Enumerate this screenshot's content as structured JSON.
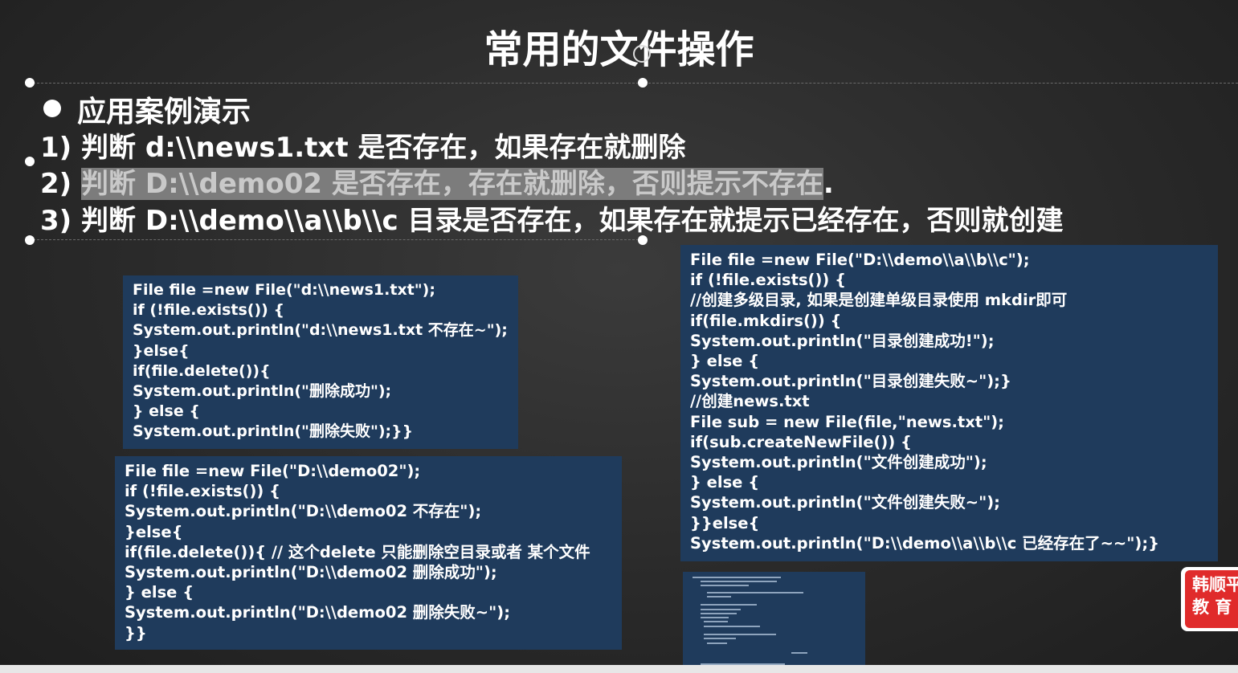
{
  "slide": {
    "title": "常用的文件操作",
    "heading": "应用案例演示",
    "items": [
      {
        "number": "1)",
        "text": "判断 d:\\\\news1.txt 是否存在，如果存在就删除"
      },
      {
        "number": "2)",
        "text_highlighted": "判断 D:\\\\demo02 是否存在，存在就删除，否则提示不存在",
        "text_tail": "."
      },
      {
        "number": "3)",
        "text": "判断 D:\\\\demo\\\\a\\\\b\\\\c 目录是否存在，如果存在就提示已经存在，否则就创建"
      }
    ]
  },
  "code_blocks": {
    "news1": [
      "File file =new File(\"d:\\\\news1.txt\");",
      "if (!file.exists()) {",
      "System.out.println(\"d:\\\\news1.txt 不存在~\");",
      "}else{",
      "if(file.delete()){",
      "System.out.println(\"删除成功\");",
      "} else {",
      "System.out.println(\"删除失败\");}}"
    ],
    "demo02": [
      "File file =new File(\"D:\\\\demo02\");",
      "if (!file.exists()) {",
      "System.out.println(\"D:\\\\demo02 不存在\");",
      "}else{",
      "if(file.delete()){ // 这个delete 只能删除空目录或者 某个文件",
      "System.out.println(\"D:\\\\demo02 删除成功\");",
      "} else {",
      "System.out.println(\"D:\\\\demo02 删除失败~\");",
      "}}"
    ],
    "demo_abc": [
      "File file =new File(\"D:\\\\demo\\\\a\\\\b\\\\c\");",
      "if (!file.exists()) {",
      "//创建多级目录, 如果是创建单级目录使用 mkdir即可",
      "if(file.mkdirs()) {",
      "System.out.println(\"目录创建成功!\");",
      "} else {",
      "System.out.println(\"目录创建失败~\");}",
      "//创建news.txt",
      "File sub = new File(file,\"news.txt\");",
      "if(sub.createNewFile()) {",
      "System.out.println(\"文件创建成功\");",
      "} else {",
      "System.out.println(\"文件创建失败~\");",
      "}}else{",
      "System.out.println(\"D:\\\\demo\\\\a\\\\b\\\\c 已经存在了~~\");}"
    ]
  },
  "badge": {
    "line1": "韩顺平",
    "line2": "教 育"
  },
  "colors": {
    "code_background": "#1f3b5c",
    "badge_red": "#e02b2b",
    "highlight_gray": "#7c7c7c"
  }
}
